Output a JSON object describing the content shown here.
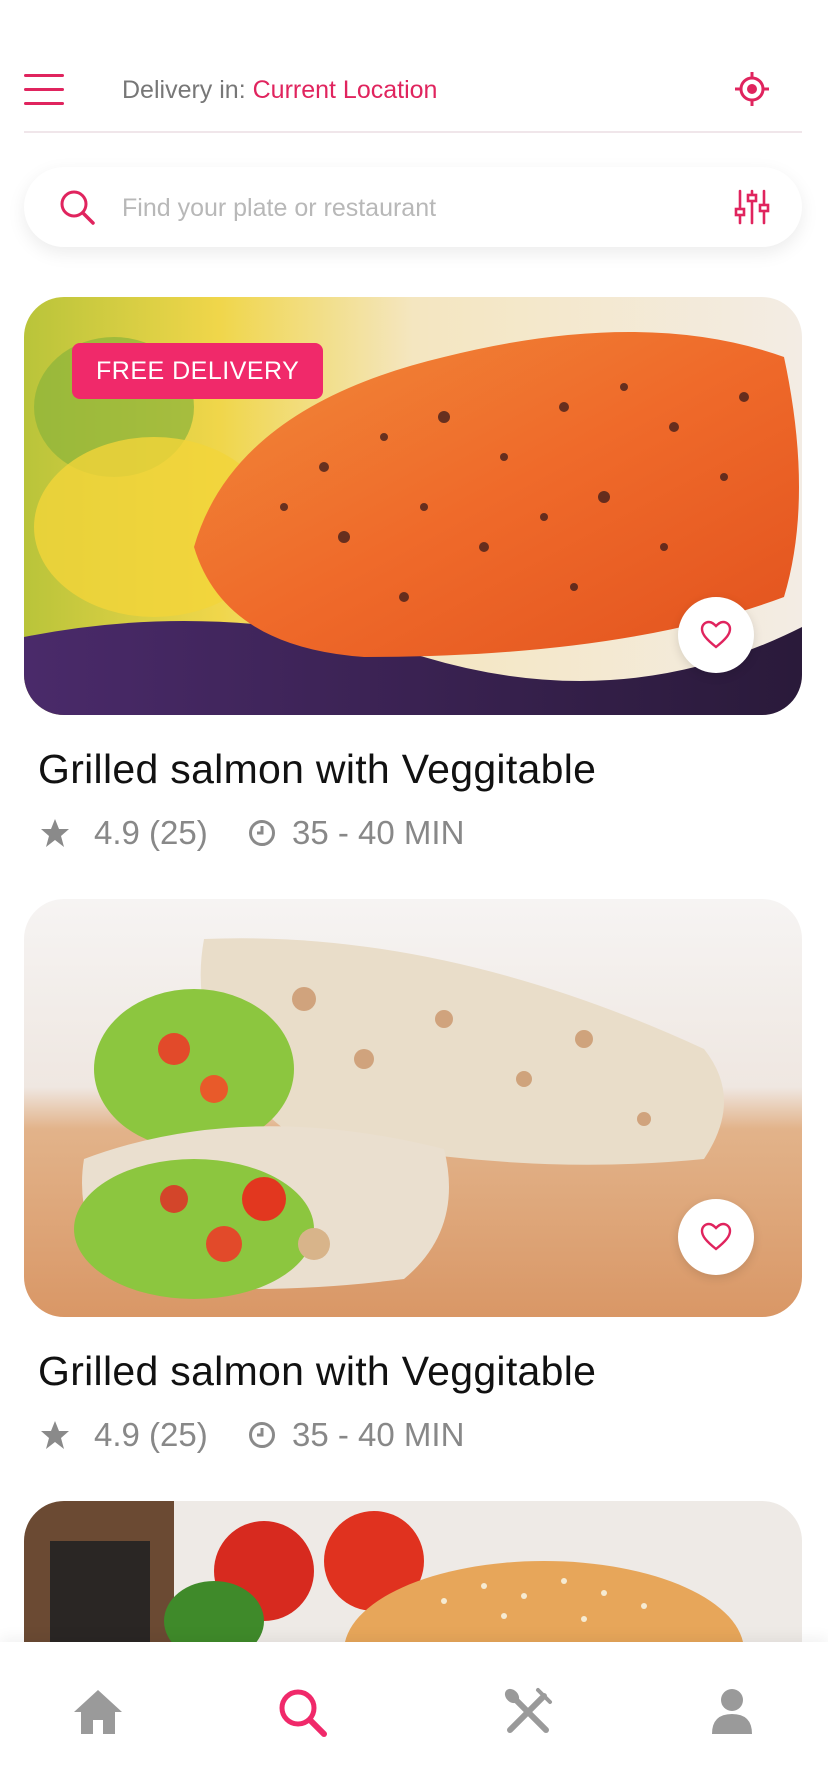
{
  "header": {
    "delivery_label": "Delivery in:",
    "delivery_location": "Current Location"
  },
  "search": {
    "placeholder": "Find your plate or restaurant",
    "value": ""
  },
  "cards": [
    {
      "badge": "FREE DELIVERY",
      "title": "Grilled salmon with Veggitable",
      "rating": "4.9 (25)",
      "time": "35 - 40 MIN"
    },
    {
      "badge": "",
      "title": "Grilled salmon with Veggitable",
      "rating": "4.9 (25)",
      "time": "35 - 40 MIN"
    }
  ],
  "icons": {
    "menu": "menu-icon",
    "locate": "target-icon",
    "search": "search-icon",
    "filter": "sliders-icon",
    "favorite": "heart-icon",
    "rating": "star-icon",
    "time": "clock-icon",
    "nav": [
      "home-icon",
      "search-icon",
      "utensils-icon",
      "user-icon"
    ]
  },
  "nav": {
    "active": "search"
  },
  "colors": {
    "accent": "#e0245e",
    "badge": "#f0296a",
    "muted_text": "#888888",
    "nav_inactive": "#9a9a9a"
  }
}
